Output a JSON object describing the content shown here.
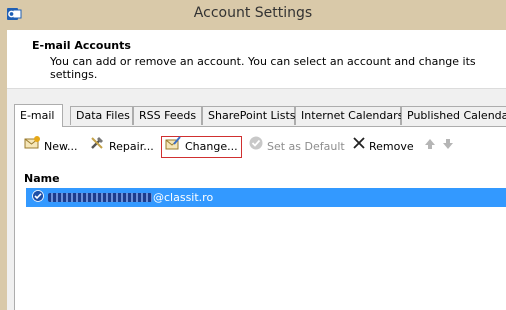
{
  "window": {
    "title": "Account Settings"
  },
  "header": {
    "title": "E-mail Accounts",
    "subtitle": "You can add or remove an account. You can select an account and change its settings."
  },
  "tabs": [
    {
      "label": "E-mail",
      "active": true
    },
    {
      "label": "Data Files"
    },
    {
      "label": "RSS Feeds"
    },
    {
      "label": "SharePoint Lists"
    },
    {
      "label": "Internet Calendars"
    },
    {
      "label": "Published Calendars"
    }
  ],
  "toolbar": {
    "new_label": "New...",
    "repair_label": "Repair...",
    "change_label": "Change...",
    "set_default_label": "Set as Default",
    "remove_label": "Remove"
  },
  "list": {
    "column_name": "Name",
    "accounts": [
      {
        "email_visible": "@classit.ro",
        "default": true,
        "selected": true
      }
    ]
  },
  "colors": {
    "selection": "#3399ff",
    "title_bar": "#d9c9a9",
    "focus_border": "#d03030"
  }
}
